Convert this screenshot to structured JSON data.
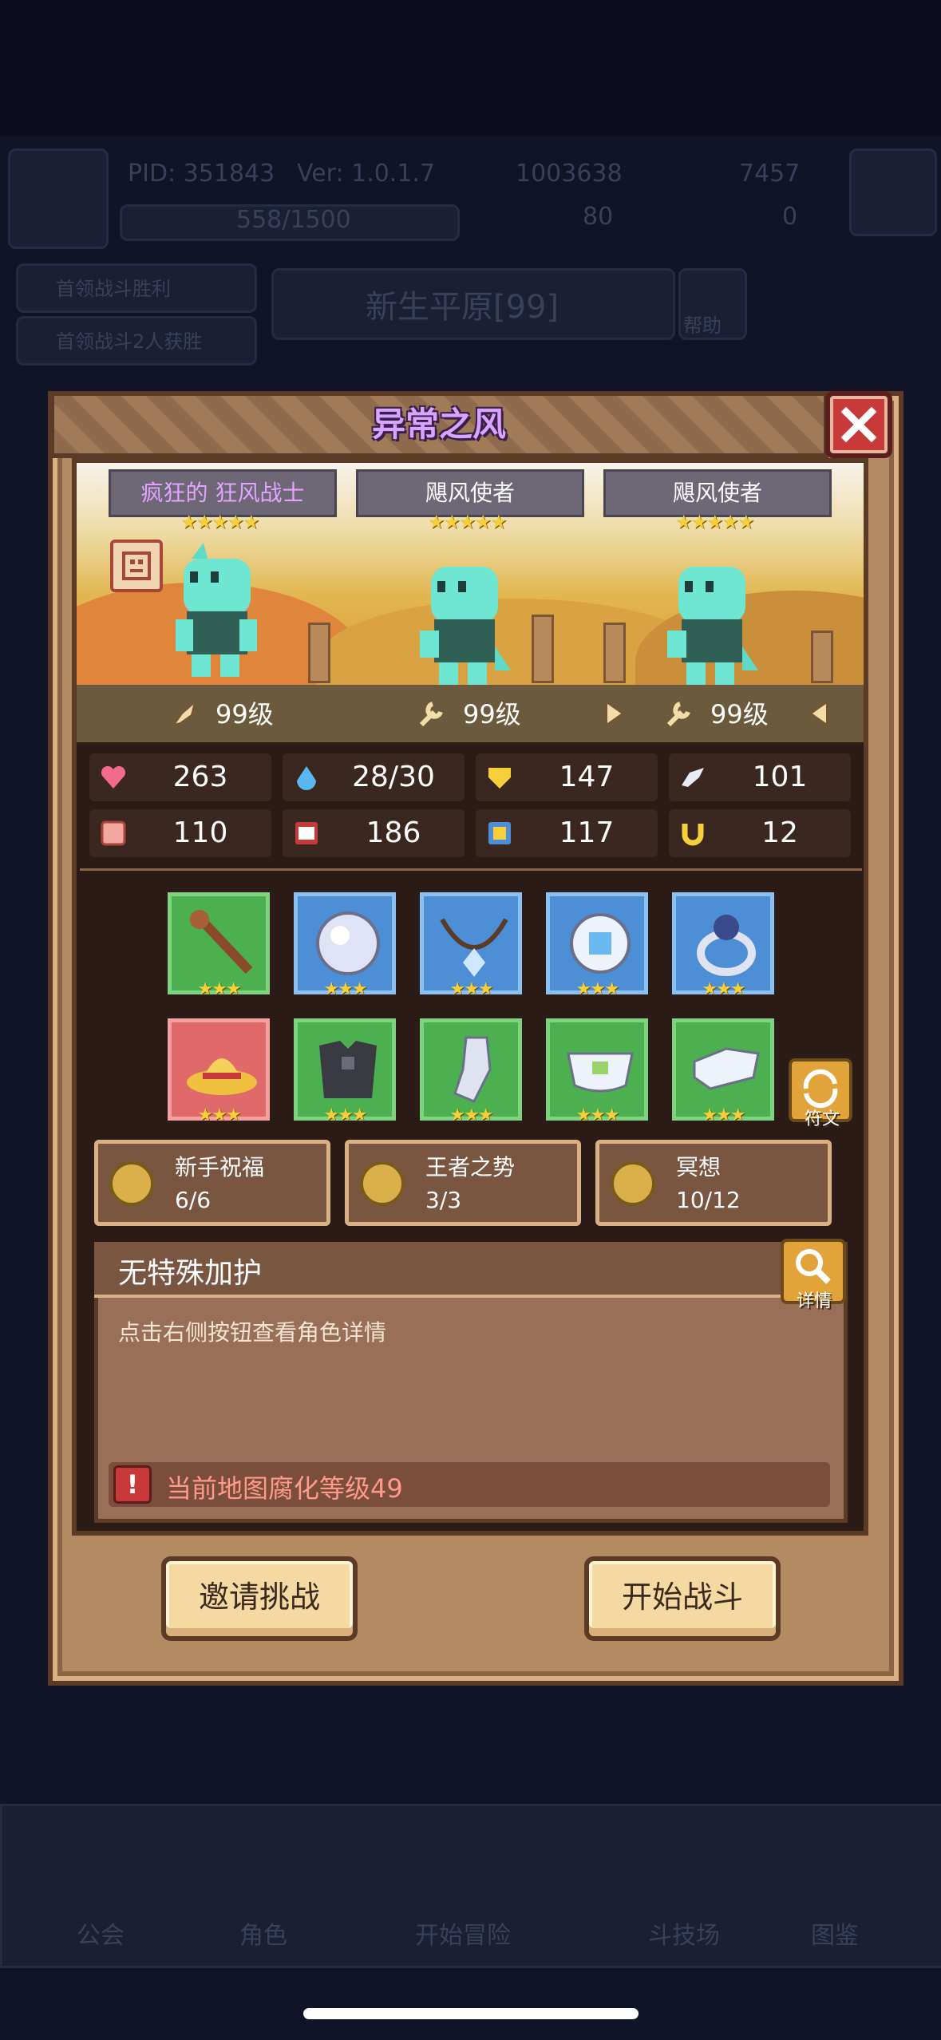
{
  "background": {
    "pid_label": "PID: 351843",
    "version_label": "Ver: 1.0.1.7",
    "gold": "1003638",
    "gems": "7457",
    "exp": "558/1500",
    "clover": "80",
    "keys": "0",
    "map_name": "新生平原[99]",
    "help_label": "帮助",
    "quest1": "首领战斗胜利",
    "quest2": "首领战斗2人获胜",
    "nav": [
      "公会",
      "角色",
      "开始冒险",
      "斗技场",
      "图鉴"
    ]
  },
  "dialog": {
    "title": "异常之风",
    "characters": [
      {
        "name": "疯狂的 狂风战士",
        "stars": "★★★★★",
        "level": "99级"
      },
      {
        "name": "飓风使者",
        "stars": "★★★★★",
        "level": "99级"
      },
      {
        "name": "飓风使者",
        "stars": "★★★★★",
        "level": "99级"
      }
    ],
    "stats": [
      {
        "icon": "heart-icon",
        "value": "263"
      },
      {
        "icon": "mana-drop-icon",
        "value": "28/30"
      },
      {
        "icon": "shield-icon",
        "value": "147"
      },
      {
        "icon": "wing-icon",
        "value": "101"
      },
      {
        "icon": "fist-icon",
        "value": "110"
      },
      {
        "icon": "spellbook-icon",
        "value": "186"
      },
      {
        "icon": "scroll-icon",
        "value": "117"
      },
      {
        "icon": "horseshoe-icon",
        "value": "12"
      }
    ],
    "equipment_stars": "★★★",
    "equipment": [
      {
        "icon": "staff-icon",
        "rarity": "green"
      },
      {
        "icon": "orb-icon",
        "rarity": "blue"
      },
      {
        "icon": "necklace-icon",
        "rarity": "blue"
      },
      {
        "icon": "gem-amulet-icon",
        "rarity": "blue"
      },
      {
        "icon": "ring-icon",
        "rarity": "blue"
      },
      {
        "icon": "straw-hat-icon",
        "rarity": "red"
      },
      {
        "icon": "dark-armor-icon",
        "rarity": "green"
      },
      {
        "icon": "gauntlet-icon",
        "rarity": "green"
      },
      {
        "icon": "belt-icon",
        "rarity": "green"
      },
      {
        "icon": "boots-icon",
        "rarity": "green"
      }
    ],
    "rune_label": "符文",
    "buffs": [
      {
        "name": "新手祝福",
        "count": "6/6"
      },
      {
        "name": "王者之势",
        "count": "3/3"
      },
      {
        "name": "冥想",
        "count": "10/12"
      }
    ],
    "protection": {
      "title": "无特殊加护",
      "detail_label": "详情",
      "hint": "点击右侧按钮查看角色详情",
      "warning_icon": "!",
      "warning": "当前地图腐化等级49"
    },
    "buttons": {
      "invite": "邀请挑战",
      "start": "开始战斗"
    }
  },
  "colors": {
    "title": "#d7a4ff",
    "warning": "#ff9a8a",
    "star": "#f6cf3b"
  }
}
